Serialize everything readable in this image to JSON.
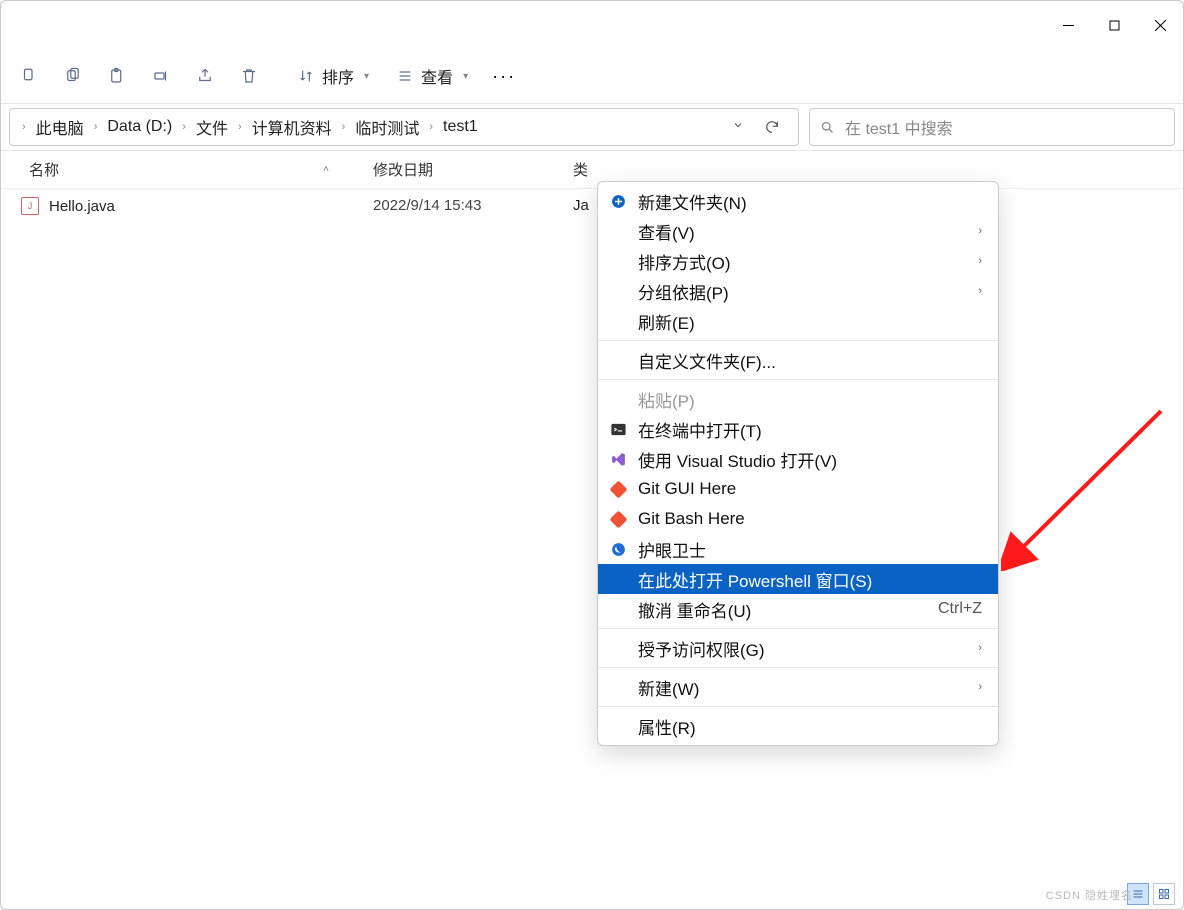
{
  "toolbar": {
    "sort_label": "排序",
    "view_label": "查看"
  },
  "breadcrumb": [
    "此电脑",
    "Data (D:)",
    "文件",
    "计算机资料",
    "临时测试",
    "test1"
  ],
  "search": {
    "placeholder": "在 test1 中搜索"
  },
  "columns": {
    "name": "名称",
    "date": "修改日期",
    "type": "类"
  },
  "files": [
    {
      "name": "Hello.java",
      "date": "2022/9/14 15:43",
      "type": "Ja"
    }
  ],
  "context_menu": {
    "new_folder": "新建文件夹(N)",
    "view": "查看(V)",
    "sort_by": "排序方式(O)",
    "group_by": "分组依据(P)",
    "refresh": "刷新(E)",
    "customize": "自定义文件夹(F)...",
    "paste": "粘贴(P)",
    "open_terminal": "在终端中打开(T)",
    "open_vs": "使用 Visual Studio 打开(V)",
    "git_gui": "Git GUI Here",
    "git_bash": "Git Bash Here",
    "eye_guard": "护眼卫士",
    "open_powershell": "在此处打开 Powershell 窗口(S)",
    "undo_rename": "撤消 重命名(U)",
    "undo_shortcut": "Ctrl+Z",
    "grant_access": "授予访问权限(G)",
    "new": "新建(W)",
    "properties": "属性(R)"
  },
  "watermark": "CSDN 隐姓埋名"
}
